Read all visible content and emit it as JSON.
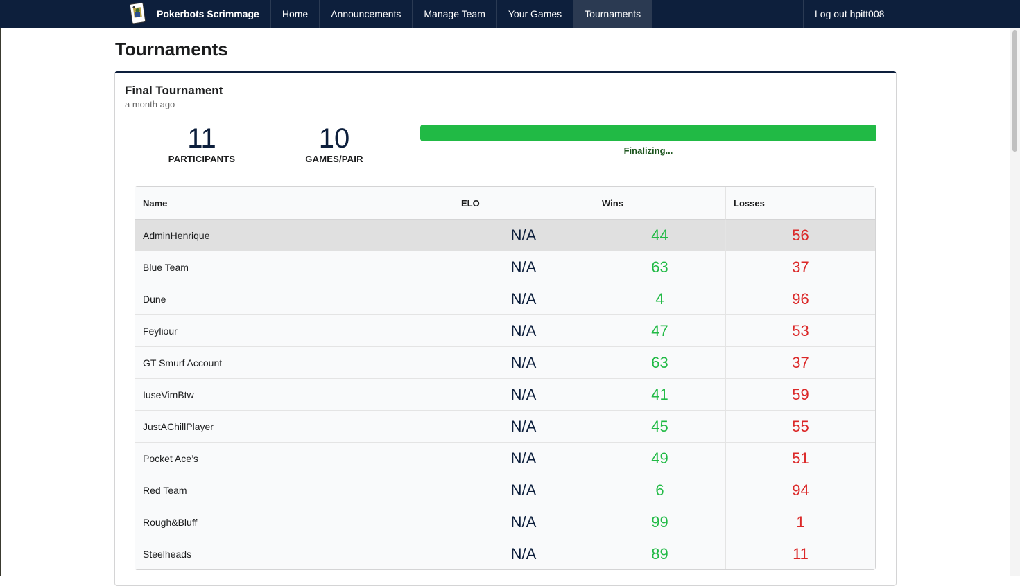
{
  "nav": {
    "brand": "Pokerbots Scrimmage",
    "items": [
      {
        "label": "Home"
      },
      {
        "label": "Announcements"
      },
      {
        "label": "Manage Team"
      },
      {
        "label": "Your Games"
      },
      {
        "label": "Tournaments"
      }
    ],
    "active": "Tournaments",
    "logout": "Log out hpitt008"
  },
  "page": {
    "title": "Tournaments"
  },
  "tournament": {
    "name": "Final Tournament",
    "time": "a month ago",
    "participants": {
      "value": "11",
      "label": "PARTICIPANTS"
    },
    "games_per_pair": {
      "value": "10",
      "label": "GAMES/PAIR"
    },
    "progress": {
      "percent": 100,
      "label": "Finalizing..."
    }
  },
  "table": {
    "headers": [
      "Name",
      "ELO",
      "Wins",
      "Losses"
    ],
    "rows": [
      {
        "name": "AdminHenrique",
        "elo": "N/A",
        "wins": "44",
        "losses": "56"
      },
      {
        "name": "Blue Team",
        "elo": "N/A",
        "wins": "63",
        "losses": "37"
      },
      {
        "name": "Dune",
        "elo": "N/A",
        "wins": "4",
        "losses": "96"
      },
      {
        "name": "Feyliour",
        "elo": "N/A",
        "wins": "47",
        "losses": "53"
      },
      {
        "name": "GT Smurf Account",
        "elo": "N/A",
        "wins": "63",
        "losses": "37"
      },
      {
        "name": "IuseVimBtw",
        "elo": "N/A",
        "wins": "41",
        "losses": "59"
      },
      {
        "name": "JustAChillPlayer",
        "elo": "N/A",
        "wins": "45",
        "losses": "55"
      },
      {
        "name": "Pocket Ace’s",
        "elo": "N/A",
        "wins": "49",
        "losses": "51"
      },
      {
        "name": "Red Team",
        "elo": "N/A",
        "wins": "6",
        "losses": "94"
      },
      {
        "name": "Rough&Bluff",
        "elo": "N/A",
        "wins": "99",
        "losses": "1"
      },
      {
        "name": "Steelheads",
        "elo": "N/A",
        "wins": "89",
        "losses": "11"
      }
    ]
  },
  "colors": {
    "navbar": "#0d1f3c",
    "wins": "#21ba45",
    "losses": "#db2828",
    "progress": "#21ba45"
  }
}
